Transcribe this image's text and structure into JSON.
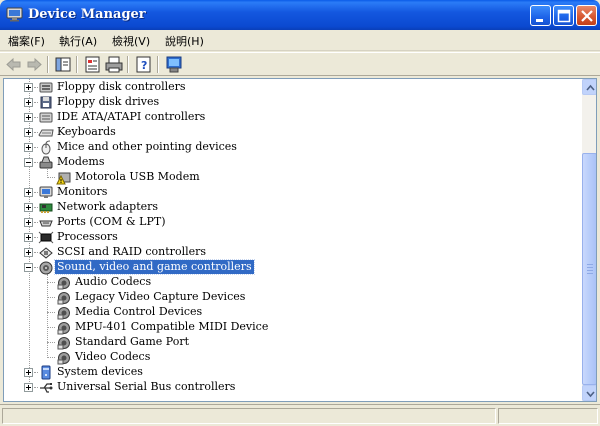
{
  "window": {
    "title": "Device Manager",
    "icon": "computer-monitor-icon",
    "controls": [
      "minimize-icon",
      "maximize-icon",
      "close-icon"
    ]
  },
  "menu": {
    "items": [
      "檔案(F)",
      "執行(A)",
      "檢視(V)",
      "說明(H)"
    ]
  },
  "toolbar": {
    "buttons": [
      "back-icon",
      "forward-icon",
      "show-hide-tree-icon",
      "properties-icon",
      "print-icon",
      "help-icon",
      "scan-hardware-icon"
    ]
  },
  "tree": {
    "items": [
      {
        "label": "Floppy disk controllers",
        "icon": "floppy-controller-icon",
        "level": 1,
        "state": "collapsed"
      },
      {
        "label": "Floppy disk drives",
        "icon": "floppy-drive-icon",
        "level": 1,
        "state": "collapsed"
      },
      {
        "label": "IDE ATA/ATAPI controllers",
        "icon": "ide-controller-icon",
        "level": 1,
        "state": "collapsed"
      },
      {
        "label": "Keyboards",
        "icon": "keyboard-icon",
        "level": 1,
        "state": "collapsed"
      },
      {
        "label": "Mice and other pointing devices",
        "icon": "mouse-icon",
        "level": 1,
        "state": "collapsed"
      },
      {
        "label": "Modems",
        "icon": "modem-icon",
        "level": 1,
        "state": "expanded"
      },
      {
        "label": "Motorola USB Modem",
        "icon": "warning-modem-icon",
        "level": 2,
        "state": "leaf"
      },
      {
        "label": "Monitors",
        "icon": "monitor-icon",
        "level": 1,
        "state": "collapsed"
      },
      {
        "label": "Network adapters",
        "icon": "network-adapter-icon",
        "level": 1,
        "state": "collapsed"
      },
      {
        "label": "Ports (COM & LPT)",
        "icon": "port-icon",
        "level": 1,
        "state": "collapsed"
      },
      {
        "label": "Processors",
        "icon": "processor-icon",
        "level": 1,
        "state": "collapsed"
      },
      {
        "label": "SCSI and RAID controllers",
        "icon": "scsi-icon",
        "level": 1,
        "state": "collapsed"
      },
      {
        "label": "Sound, video and game controllers",
        "icon": "sound-icon",
        "level": 1,
        "state": "expanded",
        "selected": true
      },
      {
        "label": "Audio Codecs",
        "icon": "sound-device-icon",
        "level": 2,
        "state": "leaf"
      },
      {
        "label": "Legacy Video Capture Devices",
        "icon": "sound-device-icon",
        "level": 2,
        "state": "leaf"
      },
      {
        "label": "Media Control Devices",
        "icon": "sound-device-icon",
        "level": 2,
        "state": "leaf"
      },
      {
        "label": "MPU-401 Compatible MIDI Device",
        "icon": "sound-device-icon",
        "level": 2,
        "state": "leaf"
      },
      {
        "label": "Standard Game Port",
        "icon": "sound-device-icon",
        "level": 2,
        "state": "leaf"
      },
      {
        "label": "Video Codecs",
        "icon": "sound-device-icon",
        "level": 2,
        "state": "leaf"
      },
      {
        "label": "System devices",
        "icon": "system-devices-icon",
        "level": 1,
        "state": "collapsed"
      },
      {
        "label": "Universal Serial Bus controllers",
        "icon": "usb-icon",
        "level": 1,
        "state": "collapsed"
      }
    ]
  },
  "status": {
    "text": ""
  },
  "colors": {
    "titlebar": "#0b49d0",
    "selection": "#316ac5",
    "chrome": "#ece9d8"
  }
}
